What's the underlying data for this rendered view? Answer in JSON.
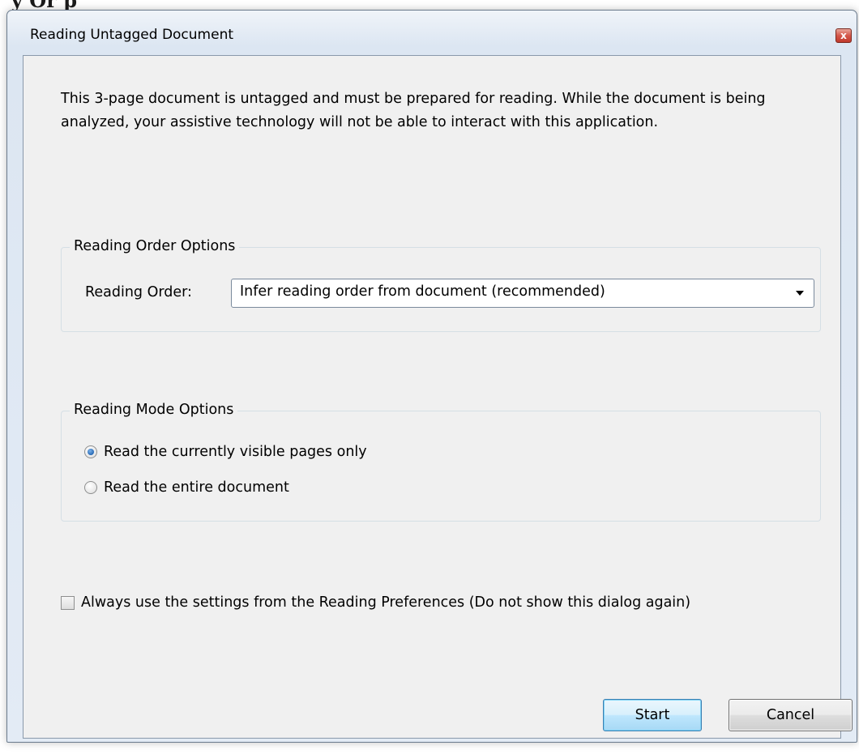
{
  "background": {
    "partial_text": "y Or p"
  },
  "window": {
    "title": "Reading Untagged Document",
    "close_glyph": "x"
  },
  "description": "This 3-page document is untagged and must be prepared for reading. While the document is being analyzed, your assistive technology will not be able to interact with this application.",
  "reading_order_group": {
    "legend": "Reading Order Options",
    "label": "Reading Order:",
    "selected_value": "Infer reading order from document (recommended)"
  },
  "reading_mode_group": {
    "legend": "Reading Mode Options",
    "options": [
      {
        "label": "Read the currently visible pages only",
        "checked": true
      },
      {
        "label": "Read the entire document",
        "checked": false
      }
    ]
  },
  "always_use_checkbox": {
    "label": "Always use the settings from the Reading Preferences (Do not show this dialog again)",
    "checked": false
  },
  "buttons": {
    "start_label": "Start",
    "cancel_label": "Cancel"
  },
  "colors": {
    "dialog_background": "#f0f0f0",
    "titlebar_background": "#dce6f2",
    "close_button": "#c7483b",
    "default_button_border": "#3c7fb1"
  },
  "icons": {
    "close": "close-icon",
    "dropdown": "chevron-down-icon"
  }
}
